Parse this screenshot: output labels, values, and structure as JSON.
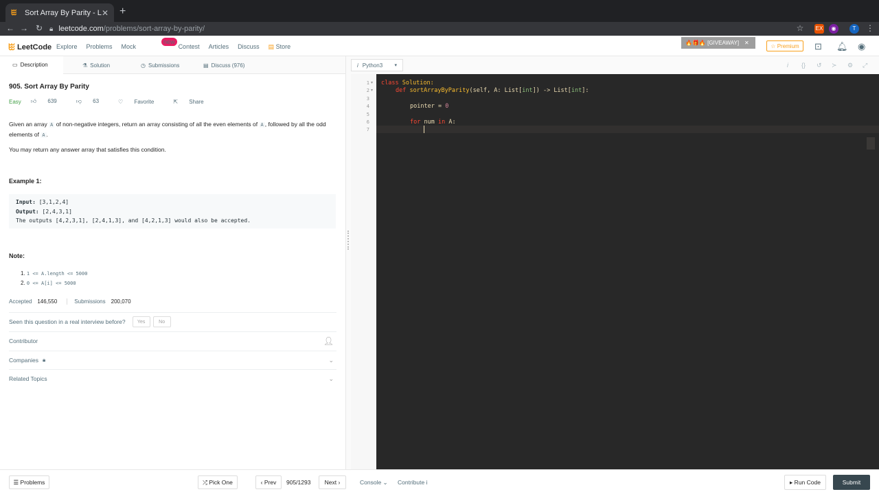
{
  "browser": {
    "tab_title": "Sort Array By Parity - LeetCode",
    "url_host": "leetcode.com",
    "url_path": "/problems/sort-array-by-parity/"
  },
  "nav": {
    "logo": "LeetCode",
    "links": [
      "Explore",
      "Problems",
      "Mock",
      "Contest",
      "Articles",
      "Discuss",
      "Store"
    ],
    "mock_badge": "new",
    "giveaway": "🔥🎁🔥 [GIVEAWAY]",
    "premium": "☆ Premium"
  },
  "left_tabs": [
    "Description",
    "Solution",
    "Submissions",
    "Discuss (976)"
  ],
  "problem": {
    "title": "905. Sort Array By Parity",
    "difficulty": "Easy",
    "likes": "639",
    "dislikes": "63",
    "favorite": "Favorite",
    "share": "Share",
    "desc_a": "Given an array ",
    "desc_code_a": "A",
    "desc_b": " of non-negative integers, return an array consisting of all the even elements of ",
    "desc_code_b": "A",
    "desc_c": ", followed by all the odd elements of ",
    "desc_code_c": "A",
    "desc_d": ".",
    "desc2": "You may return any answer array that satisfies this condition.",
    "example_heading": "Example 1:",
    "ex_input_label": "Input:",
    "ex_input": " [3,1,2,4]",
    "ex_output_label": "Output:",
    "ex_output": " [2,4,3,1]",
    "ex_note": "The outputs [4,2,3,1], [2,4,1,3], and [4,2,1,3] would also be accepted.",
    "note_heading": "Note:",
    "notes": [
      "1 <= A.length <= 5000",
      "0 <= A[i] <= 5000"
    ],
    "accepted_label": "Accepted",
    "accepted": "146,550",
    "submissions_label": "Submissions",
    "submissions": "200,070",
    "interview_q": "Seen this question in a real interview before?",
    "yes": "Yes",
    "no": "No",
    "contributor": "Contributor",
    "companies": "Companies",
    "related": "Related Topics"
  },
  "editor": {
    "language": "Python3",
    "line_numbers": [
      "1",
      "2",
      "3",
      "4",
      "5",
      "6",
      "7"
    ],
    "line1_kw": "class",
    "line1_name": " Solution:",
    "line2_kw": "def",
    "line2_fn": " sortArrayByParity",
    "line2_a": "(self, A: List[",
    "line2_t1": "int",
    "line2_b": "]) -> List[",
    "line2_t2": "int",
    "line2_c": "]:",
    "line4_a": "pointer = ",
    "line4_num": "0",
    "line6_kw": "for",
    "line6_a": " num ",
    "line6_kw2": "in",
    "line6_b": " A:"
  },
  "footer": {
    "problems": "☰ Problems",
    "pick_one": "⤮ Pick One",
    "prev": "‹ Prev",
    "page": "905/1293",
    "next": "Next ›",
    "console": "Console ⌄",
    "contribute": "Contribute i",
    "run_code": "▸ Run Code",
    "submit": "Submit"
  }
}
